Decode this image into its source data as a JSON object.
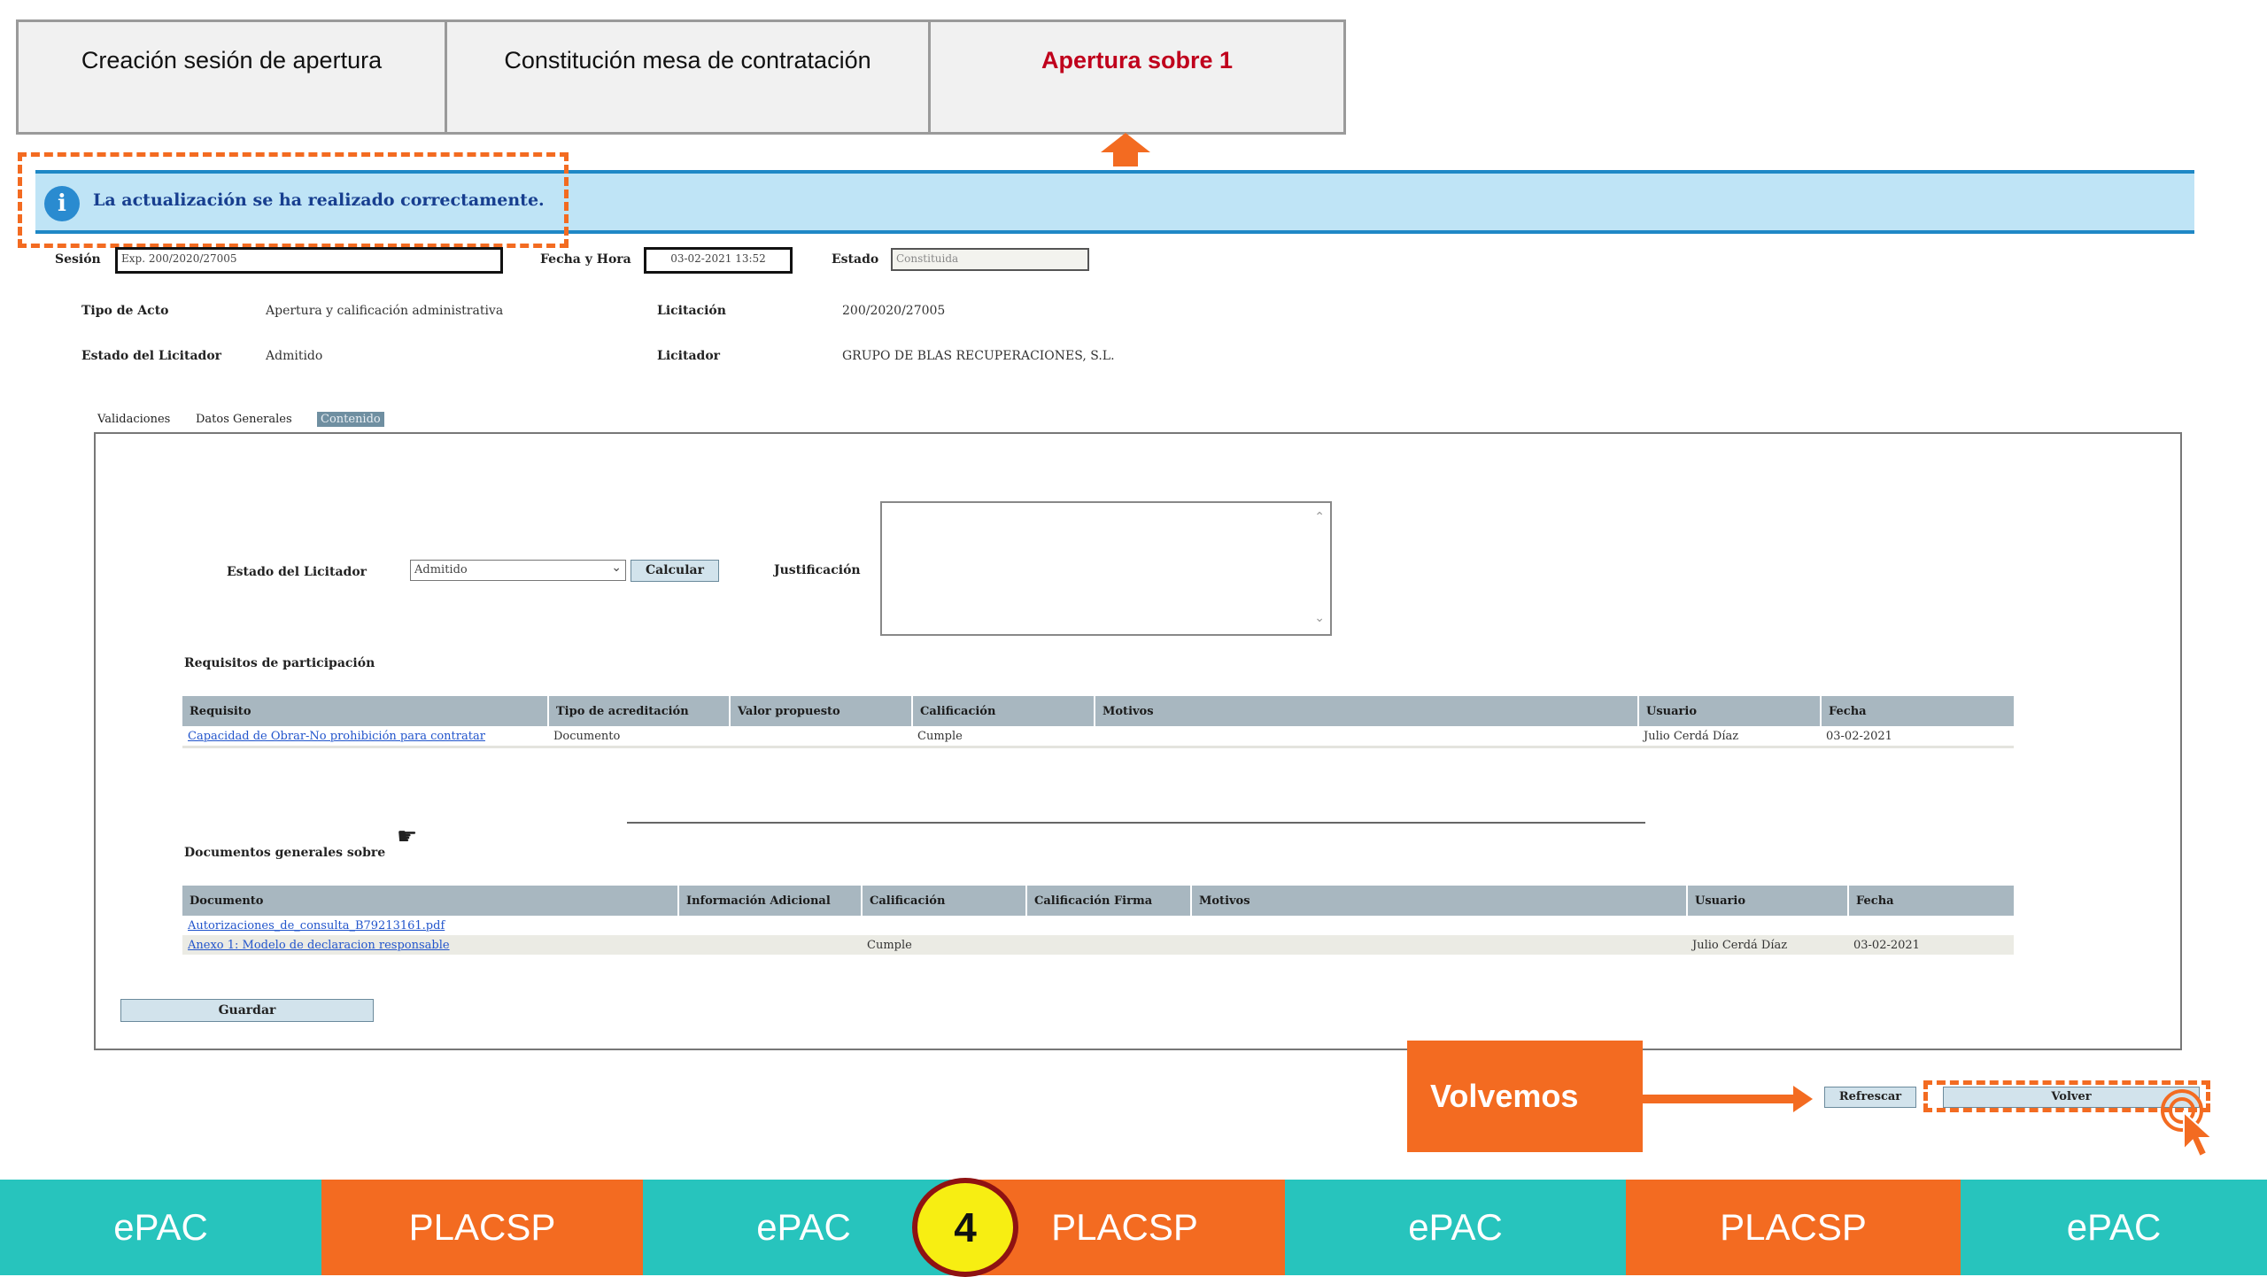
{
  "steps": [
    {
      "label": "Creación sesión de apertura",
      "active": false
    },
    {
      "label": "Constitución mesa de contratación",
      "active": false
    },
    {
      "label": "Apertura sobre 1",
      "active": true
    }
  ],
  "info": {
    "icon": "info-icon",
    "message": "La actualización se ha realizado correctamente."
  },
  "session": {
    "sesion_label": "Sesión",
    "sesion_value": "Exp. 200/2020/27005",
    "fecha_label": "Fecha y Hora",
    "fecha_value": "03-02-2021 13:52",
    "estado_label": "Estado",
    "estado_value": "Constituida"
  },
  "details": {
    "tipo_acto_label": "Tipo de Acto",
    "tipo_acto_value": "Apertura y calificación administrativa",
    "licitacion_label": "Licitación",
    "licitacion_value": "200/2020/27005",
    "estado_licitador_label": "Estado del Licitador",
    "estado_licitador_value": "Admitido",
    "licitador_label": "Licitador",
    "licitador_value": "GRUPO DE BLAS RECUPERACIONES, S.L."
  },
  "tabs": [
    {
      "label": "Validaciones",
      "selected": false
    },
    {
      "label": "Datos Generales",
      "selected": false
    },
    {
      "label": "Contenido",
      "selected": true
    }
  ],
  "form": {
    "estado_label": "Estado del Licitador",
    "estado_selected": "Admitido",
    "calcular_label": "Calcular",
    "justificacion_label": "Justificación",
    "justificacion_value": ""
  },
  "requisitos": {
    "title": "Requisitos de participación",
    "columns": [
      "Requisito",
      "Tipo de acreditación",
      "Valor propuesto",
      "Calificación",
      "Motivos",
      "Usuario",
      "Fecha"
    ],
    "rows": [
      [
        "Capacidad de Obrar-No prohibición para contratar",
        "Documento",
        "",
        "Cumple",
        "",
        "Julio Cerdá Díaz",
        "03-02-2021"
      ]
    ]
  },
  "documentos": {
    "title": "Documentos generales sobre",
    "columns": [
      "Documento",
      "Información Adicional",
      "Calificación",
      "Calificación Firma",
      "Motivos",
      "Usuario",
      "Fecha"
    ],
    "rows": [
      [
        "Autorizaciones_de_consulta_B79213161.pdf",
        "",
        "",
        "",
        "",
        "",
        ""
      ],
      [
        "Anexo 1: Modelo de declaracion responsable",
        "",
        "Cumple",
        "",
        "",
        "Julio Cerdá Díaz",
        "03-02-2021"
      ]
    ]
  },
  "buttons": {
    "guardar": "Guardar",
    "refrescar": "Refrescar",
    "volver": "Volver"
  },
  "callout": {
    "label": "Volvemos"
  },
  "bottom_strip": {
    "segments": [
      "ePAC",
      "PLACSP",
      "ePAC",
      "PLACSP",
      "ePAC",
      "PLACSP",
      "ePAC"
    ],
    "step_number": "4"
  },
  "colors": {
    "accent_orange": "#f36b21",
    "teal": "#27c4bd",
    "active_step": "#c0001c",
    "info_bg": "#bfe4f6"
  }
}
